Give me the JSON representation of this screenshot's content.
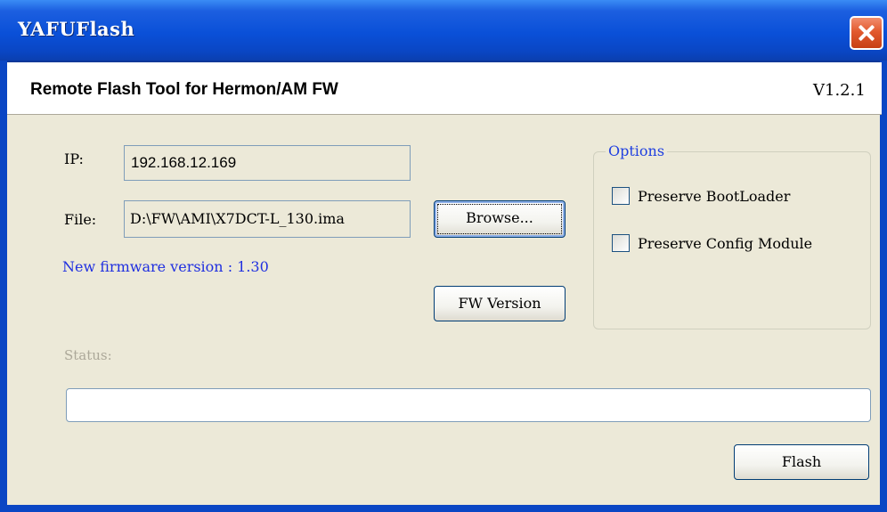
{
  "window": {
    "title": "YAFUFlash",
    "header_title": "Remote Flash Tool for Hermon/AM FW",
    "version": "V1.2.1"
  },
  "form": {
    "ip_label": "IP:",
    "ip_value": "192.168.12.169",
    "file_label": "File:",
    "file_value": "D:\\FW\\AMI\\X7DCT-L_130.ima",
    "browse_label": "Browse...",
    "new_fw_text": "New firmware version : 1.30",
    "fw_version_label": "FW Version"
  },
  "options": {
    "legend": "Options",
    "preserve_bootloader": {
      "label": "Preserve BootLoader",
      "checked": false
    },
    "preserve_config": {
      "label": "Preserve Config Module",
      "checked": false
    }
  },
  "status": {
    "label": "Status:",
    "progress": 0
  },
  "actions": {
    "flash_label": "Flash"
  },
  "colors": {
    "titlebar": "#0a50d8",
    "dialog_bg": "#ece9d8",
    "info_text": "#1f2fe0",
    "close_button": "#e25a2f"
  }
}
